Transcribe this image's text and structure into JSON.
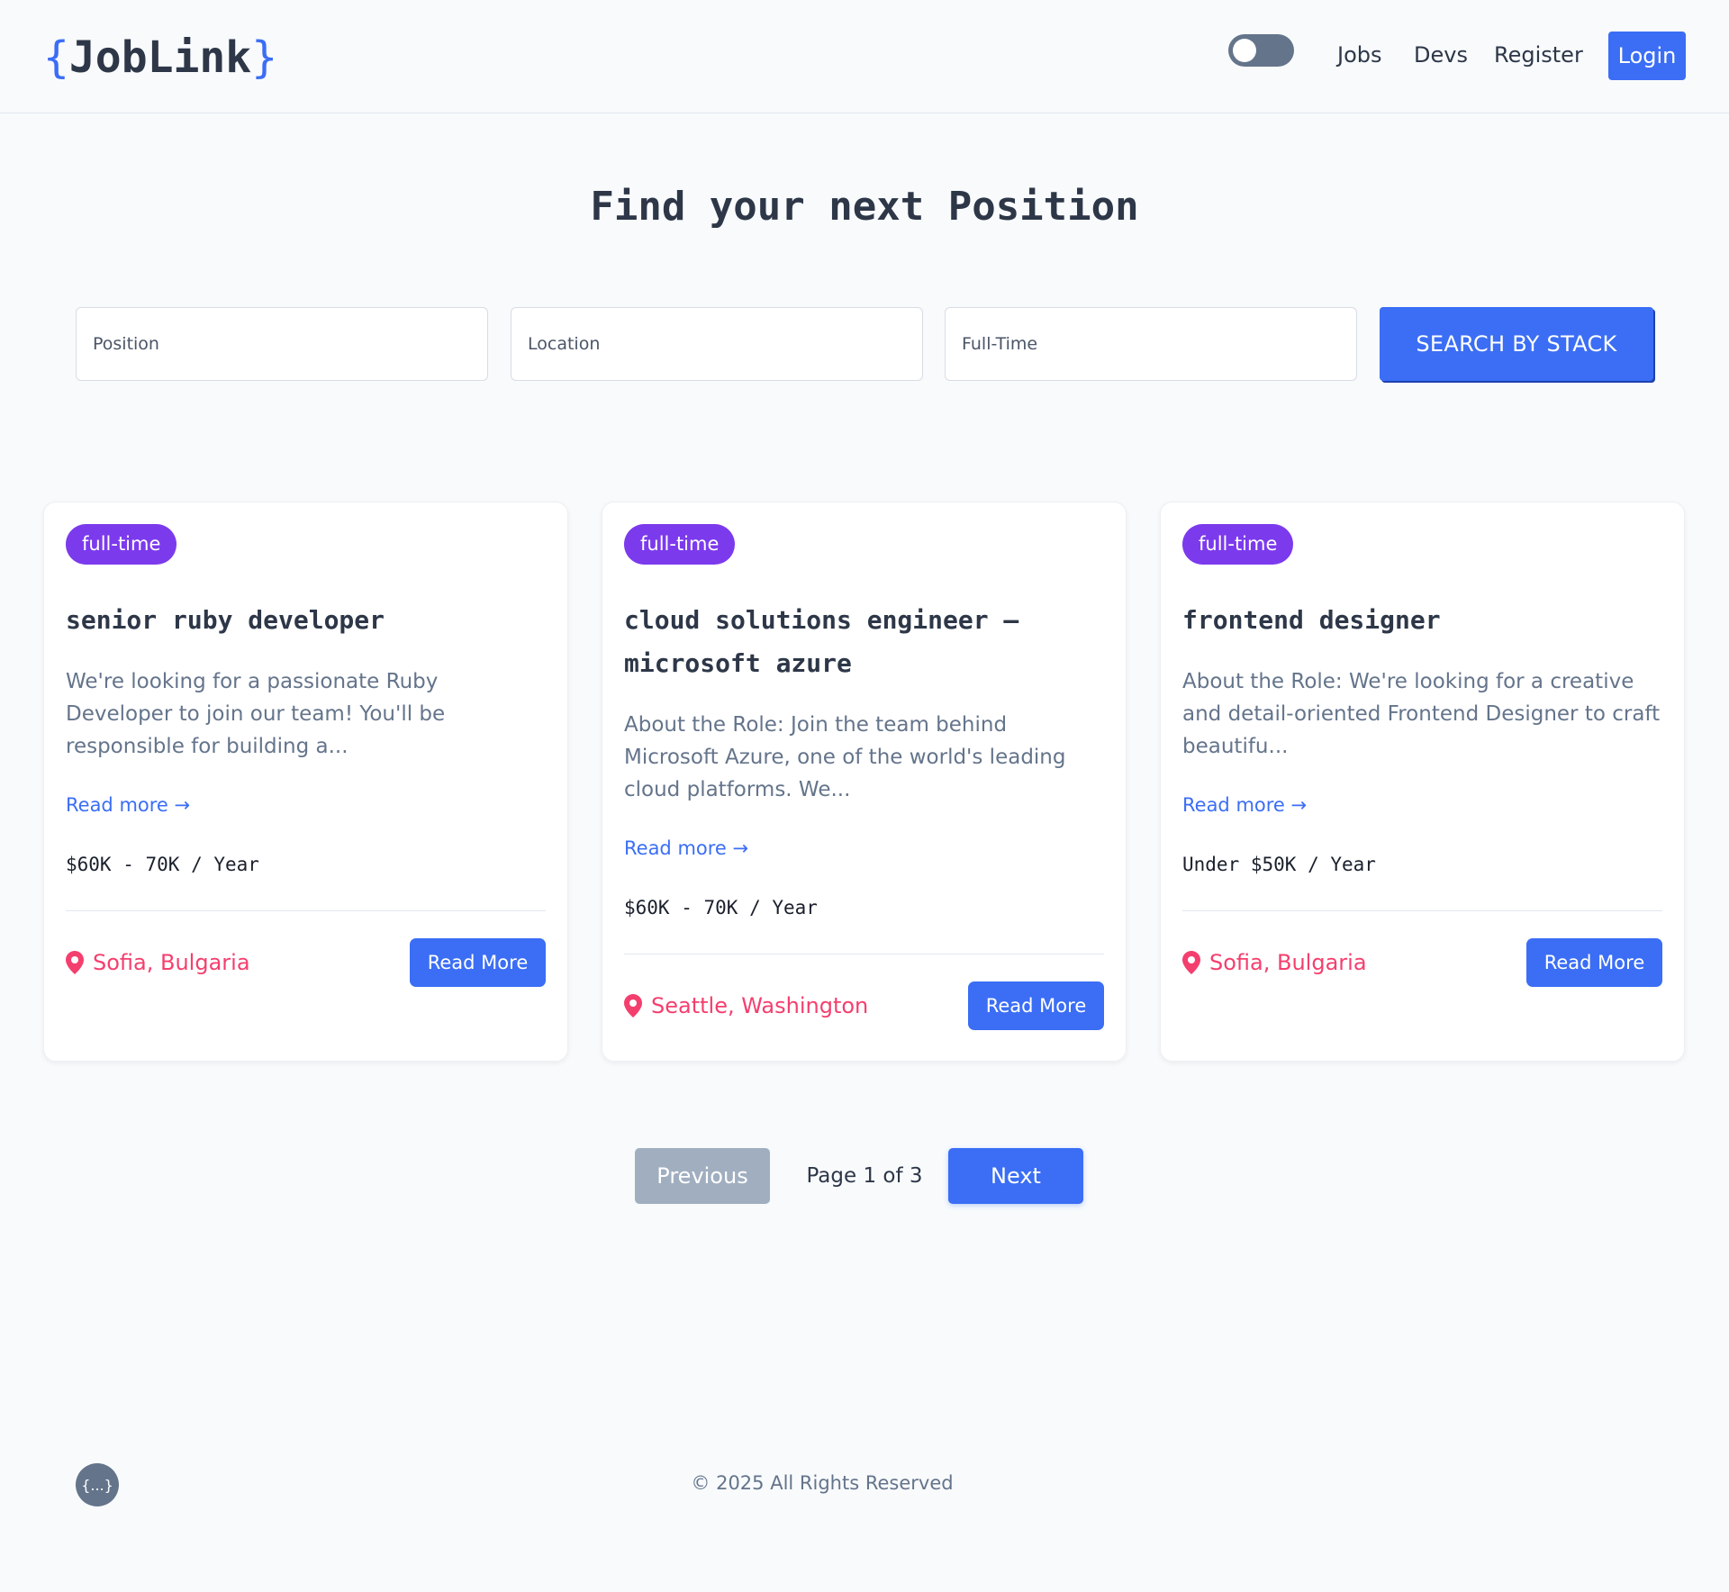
{
  "header": {
    "logo_open": "{",
    "logo_text": "JobLink",
    "logo_close": "}",
    "nav": [
      "Jobs",
      "Devs",
      "Register"
    ],
    "login_label": "Login"
  },
  "hero": {
    "title": "Find your next Position"
  },
  "search": {
    "position_placeholder": "Position",
    "location_placeholder": "Location",
    "type_placeholder": "Full-Time",
    "button_label": "SEARCH BY STACK"
  },
  "jobs": [
    {
      "badge": "full-time",
      "title": "senior ruby developer",
      "description": "We're looking for a passionate Ruby Developer to join our team! You'll be responsible for building a...",
      "read_more": "Read more →",
      "salary": "$60K - 70K / Year",
      "location": "Sofia, Bulgaria",
      "button_label": "Read More"
    },
    {
      "badge": "full-time",
      "title": "cloud solutions engineer – microsoft azure",
      "description": "About the Role: Join the team behind Microsoft Azure, one of the world's leading cloud platforms. We...",
      "read_more": "Read more →",
      "salary": "$60K - 70K / Year",
      "location": "Seattle, Washington",
      "button_label": "Read More"
    },
    {
      "badge": "full-time",
      "title": "frontend designer",
      "description": "About the Role: We're looking for a creative and detail-oriented Frontend Designer to craft beautifu...",
      "read_more": "Read more →",
      "salary": "Under $50K / Year",
      "location": "Sofia, Bulgaria",
      "button_label": "Read More"
    }
  ],
  "pagination": {
    "previous_label": "Previous",
    "page_info": "Page 1 of 3",
    "next_label": "Next"
  },
  "footer": {
    "logo_text": "{...}",
    "copyright": "© 2025 All Rights Reserved"
  },
  "colors": {
    "accent": "#3b6ef5",
    "badge": "#7c3aed",
    "location": "#f43f6e",
    "disabled": "#a0aec0"
  }
}
